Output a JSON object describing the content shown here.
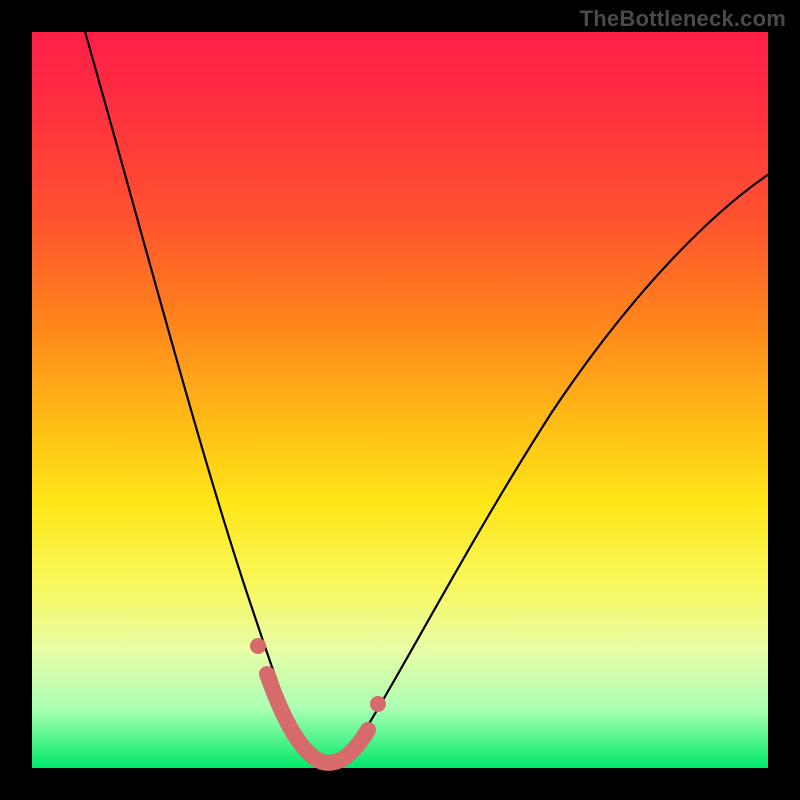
{
  "watermark": "TheBottleneck.com",
  "chart_data": {
    "type": "line",
    "title": "",
    "xlabel": "",
    "ylabel": "",
    "xlim": [
      0,
      100
    ],
    "ylim": [
      0,
      100
    ],
    "legend": false,
    "background_gradient": {
      "top": "#ff1f47",
      "bottom": "#00e96a"
    },
    "series": [
      {
        "name": "bottleneck-curve",
        "x": [
          8,
          12,
          16,
          20,
          24,
          28,
          30,
          32,
          34,
          36,
          38,
          40,
          44,
          50,
          58,
          66,
          74,
          82,
          90,
          100
        ],
        "y": [
          100,
          86,
          72,
          58,
          44,
          28,
          20,
          12,
          6,
          2,
          0,
          0,
          2,
          6,
          14,
          26,
          38,
          50,
          62,
          74
        ]
      }
    ],
    "highlighted_points": {
      "name": "highlighted-range",
      "x": [
        30,
        32,
        34,
        36,
        38,
        40,
        42,
        44
      ],
      "y": [
        20,
        12,
        6,
        2,
        0,
        0,
        2,
        6
      ]
    }
  }
}
